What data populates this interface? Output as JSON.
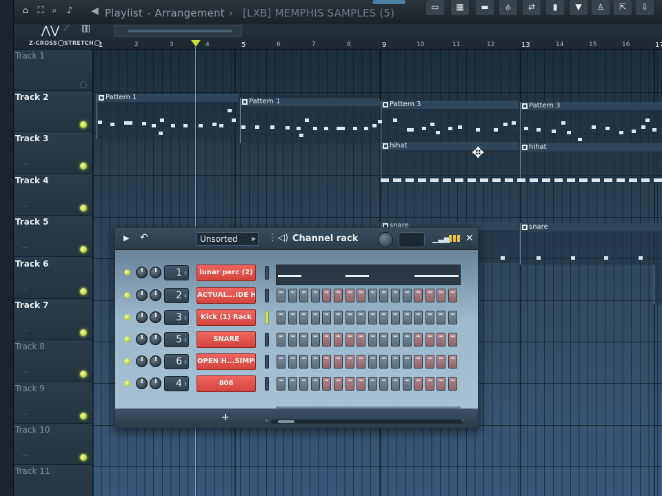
{
  "window": {
    "title_part1": "Playlist",
    "title_part2": "Arrangement",
    "project": "[LXB] MEMPHIS SAMPLES (5)"
  },
  "toolbar": {
    "mode_zcross": "Z-CROSS",
    "mode_stretch": "STRETCH"
  },
  "ruler": {
    "bars": [
      "1",
      "2",
      "3",
      "4",
      "5",
      "6",
      "7",
      "8",
      "9",
      "10",
      "11",
      "12",
      "13",
      "14",
      "15",
      "16",
      "17"
    ]
  },
  "tracks": [
    {
      "name": "Track 1"
    },
    {
      "name": "Track 2"
    },
    {
      "name": "Track 3"
    },
    {
      "name": "Track 4"
    },
    {
      "name": "Track 5"
    },
    {
      "name": "Track 6"
    },
    {
      "name": "Track 7"
    },
    {
      "name": "Track 8"
    },
    {
      "name": "Track 9"
    },
    {
      "name": "Track 10"
    },
    {
      "name": "Track 11"
    }
  ],
  "clips": {
    "pattern1_a": "Pattern 1",
    "pattern1_b": "Pattern 1",
    "pattern3_a": "Pattern 3",
    "pattern3_b": "Pattern 3",
    "hihat_a": "hihat",
    "hihat_b": "hihat",
    "snare_a": "snare",
    "snare_b": "snare"
  },
  "channel_rack": {
    "filter": "Unsorted",
    "title": "Channel rack",
    "add_symbol": "+",
    "channels": [
      {
        "number": "1",
        "name": "lunar perc (2)"
      },
      {
        "number": "2",
        "name": "ACTUAL...IDE HAT"
      },
      {
        "number": "3",
        "name": "Kick (1) Rack"
      },
      {
        "number": "5",
        "name": "SNARE"
      },
      {
        "number": "6",
        "name": "OPEN H...SIMPLE"
      },
      {
        "number": "4",
        "name": "808"
      }
    ]
  },
  "colors": {
    "channel_button": "#e0504a",
    "led": "#c6e24a",
    "marker": "#c9e03a"
  }
}
